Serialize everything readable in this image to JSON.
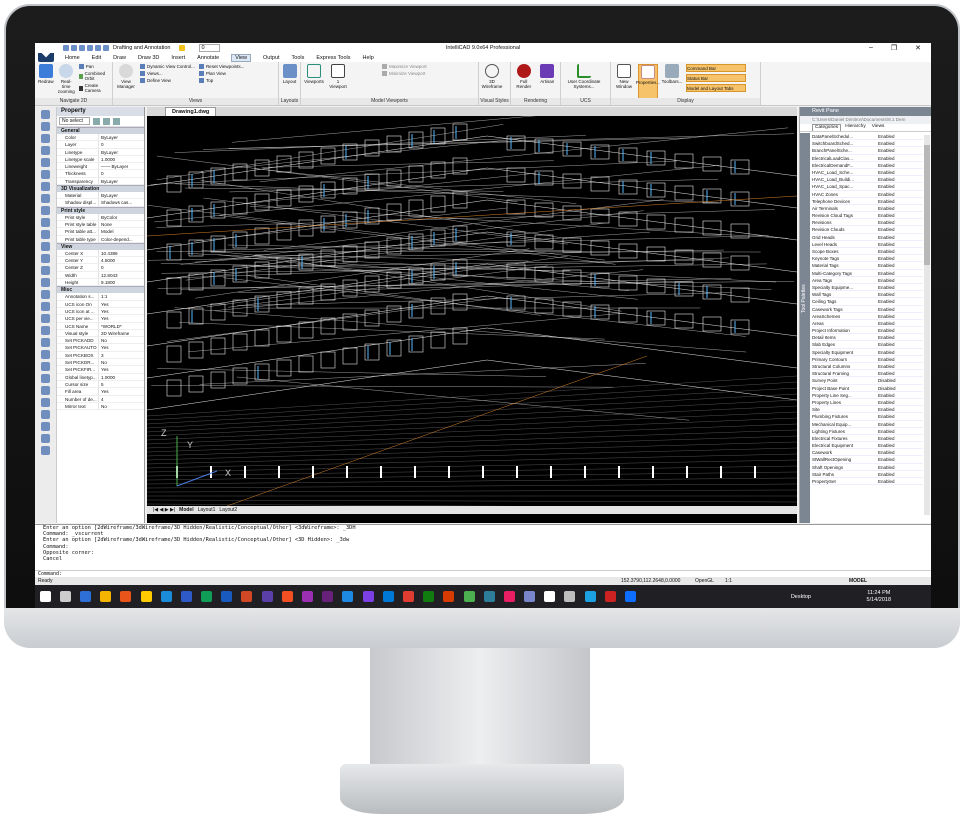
{
  "window": {
    "title": "IntelliCAD 9.0x64 Professional",
    "workspace": "Drafting and Annotation",
    "layer_value": "0",
    "controls": [
      "–",
      "❐",
      "✕"
    ]
  },
  "menu_tabs": [
    "Home",
    "Edit",
    "Draw",
    "Draw 3D",
    "Insert",
    "Annotate",
    "View",
    "Output",
    "Tools",
    "Express Tools",
    "Help"
  ],
  "active_tab": "View",
  "ribbon": {
    "navigate": {
      "label": "Navigate 2D",
      "buttons": [
        "Redraw",
        "Real-time zooming"
      ],
      "small": [
        "Pan",
        "Combined Orbit",
        "Create Camera"
      ]
    },
    "views": {
      "label": "Views",
      "buttons": [
        "View Manager"
      ],
      "small": [
        "Dynamic View Control...",
        "Views...",
        "Define View",
        "Reset Viewpoints...",
        "Plan View",
        "Top"
      ]
    },
    "layouts": {
      "label": "Layouts",
      "buttons": [
        "Layout"
      ]
    },
    "model_viewports": {
      "label": "Model Viewports",
      "buttons": [
        "Viewports",
        "1 Viewport"
      ],
      "small": [
        "Maximize Viewport",
        "Minimize Viewport"
      ]
    },
    "visual_styles": {
      "label": "Visual Styles",
      "buttons": [
        "3D Wireframe"
      ]
    },
    "rendering": {
      "label": "Rendering",
      "buttons": [
        "Full Render",
        "Artisan"
      ]
    },
    "ucs": {
      "label": "UCS",
      "buttons": [
        "User Coordinate Systems..."
      ]
    },
    "display": {
      "label": "Display",
      "buttons": [
        "New Window",
        "Properties...",
        "Toolbars..."
      ],
      "toggles": [
        "Command Bar",
        "Status Bar",
        "Model and Layout Tabs"
      ]
    }
  },
  "properties": {
    "title": "Property",
    "selection": "No select",
    "sections": [
      {
        "name": "General",
        "rows": [
          [
            "Color",
            "ByLayer"
          ],
          [
            "Layer",
            "0"
          ],
          [
            "Linetype",
            "ByLayer"
          ],
          [
            "Linetype scale",
            "1.0000"
          ],
          [
            "Lineweight",
            "—— ByLayer"
          ],
          [
            "Thickness",
            "0"
          ],
          [
            "Transparency",
            "ByLayer"
          ]
        ]
      },
      {
        "name": "3D Visualization",
        "rows": [
          [
            "Material",
            "ByLayer"
          ],
          [
            "Shadow displ...",
            "Shadows cas..."
          ]
        ]
      },
      {
        "name": "Print style",
        "rows": [
          [
            "Print style",
            "ByColor"
          ],
          [
            "Print style table",
            "None"
          ],
          [
            "Print table att...",
            "Model"
          ],
          [
            "Print table type",
            "Color-depend..."
          ]
        ]
      },
      {
        "name": "View",
        "rows": [
          [
            "Center X",
            "10.4386"
          ],
          [
            "Center Y",
            "4.5000"
          ],
          [
            "Center Z",
            "0"
          ],
          [
            "Width",
            "12.8043"
          ],
          [
            "Height",
            "9.1800"
          ]
        ]
      },
      {
        "name": "Misc",
        "rows": [
          [
            "Annotation s...",
            "1:1"
          ],
          [
            "UCS icon On",
            "Yes"
          ],
          [
            "UCS icon at ...",
            "Yes"
          ],
          [
            "UCS per vie...",
            "Yes"
          ],
          [
            "UCS Name",
            "*WORLD*"
          ],
          [
            "Visual style",
            "2D Wireframe"
          ],
          [
            "Set PICKADD",
            "No"
          ],
          [
            "Set PICKAUTO",
            "Yes"
          ],
          [
            "Set PICKBOX",
            "3"
          ],
          [
            "Set PICKDR...",
            "No"
          ],
          [
            "Set PICKFIR...",
            "Yes"
          ],
          [
            "Global linetyp...",
            "1.0000"
          ],
          [
            "Cursor size",
            "5"
          ],
          [
            "Fill area",
            "Yes"
          ],
          [
            "Number of de...",
            "4"
          ],
          [
            "Mirror text",
            "No"
          ]
        ]
      }
    ]
  },
  "document": {
    "tab": "Drawing1.dwg",
    "layout_tabs": [
      "Model",
      "Layout1",
      "Layout2"
    ],
    "active_layout": "Model",
    "axis_labels": {
      "z": "Z",
      "y": "Y",
      "x": "X"
    }
  },
  "revit_pane": {
    "title": "Revit Pane",
    "path": "C:\\Users\\Daniel Dimitrov\\Documents\\8.1 Dem",
    "tabs": [
      "Categories",
      "Hierarchy",
      "Views"
    ],
    "side_label": "Tool Palettes",
    "rows": [
      [
        "DataPanelSchedul...",
        "Enabled"
      ],
      [
        "SwitchboardSched...",
        "Enabled"
      ],
      [
        "BranchPanelSche...",
        "Enabled"
      ],
      [
        "ElectricalLoadClas...",
        "Enabled"
      ],
      [
        "ElectricalDemandF...",
        "Enabled"
      ],
      [
        "HVAC_Load_Sche...",
        "Enabled"
      ],
      [
        "HVAC_Load_Buildi...",
        "Enabled"
      ],
      [
        "HVAC_Load_Spac...",
        "Enabled"
      ],
      [
        "HVAC Zones",
        "Enabled"
      ],
      [
        "Telephone Devices",
        "Enabled"
      ],
      [
        "Air Terminals",
        "Enabled"
      ],
      [
        "Revision Cloud Tags",
        "Enabled"
      ],
      [
        "Revisions",
        "Enabled"
      ],
      [
        "Revision Clouds",
        "Enabled"
      ],
      [
        "Grid Heads",
        "Enabled"
      ],
      [
        "Level Heads",
        "Enabled"
      ],
      [
        "Scope Boxes",
        "Enabled"
      ],
      [
        "Keynote Tags",
        "Enabled"
      ],
      [
        "Material Tags",
        "Enabled"
      ],
      [
        "Multi-Category Tags",
        "Enabled"
      ],
      [
        "Area Tags",
        "Enabled"
      ],
      [
        "Specialty Equipme...",
        "Enabled"
      ],
      [
        "Wall Tags",
        "Enabled"
      ],
      [
        "Ceiling Tags",
        "Enabled"
      ],
      [
        "Casework Tags",
        "Enabled"
      ],
      [
        "AreaSchemes",
        "Enabled"
      ],
      [
        "Areas",
        "Enabled"
      ],
      [
        "Project Information",
        "Enabled"
      ],
      [
        "Detail Items",
        "Enabled"
      ],
      [
        "Slab Edges",
        "Enabled"
      ],
      [
        "Specialty Equipment",
        "Enabled"
      ],
      [
        "Primary Contours",
        "Enabled"
      ],
      [
        "Structural Columns",
        "Enabled"
      ],
      [
        "Structural Framing",
        "Enabled"
      ],
      [
        "Survey Point",
        "Disabled"
      ],
      [
        "Project Base Point",
        "Disabled"
      ],
      [
        "Property Line Seg...",
        "Enabled"
      ],
      [
        "Property Lines",
        "Enabled"
      ],
      [
        "Site",
        "Enabled"
      ],
      [
        "Plumbing Fixtures",
        "Enabled"
      ],
      [
        "Mechanical Equip...",
        "Enabled"
      ],
      [
        "Lighting Fixtures",
        "Enabled"
      ],
      [
        "Electrical Fixtures",
        "Enabled"
      ],
      [
        "Electrical Equipment",
        "Enabled"
      ],
      [
        "Casework",
        "Enabled"
      ],
      [
        "StWallRectOpening",
        "Enabled"
      ],
      [
        "Shaft Openings",
        "Enabled"
      ],
      [
        "Stair Paths",
        "Enabled"
      ],
      [
        "PropertySet",
        "Enabled"
      ]
    ]
  },
  "command_history": [
    "Enter an option [2dWireframe/3dWireframe/3D Hidden/Realistic/Conceptual/Other] <3dWireframe>: _3DH",
    "Command: _vscurrent",
    "Enter an option [2dWireframe/3dWireframe/3D Hidden/Realistic/Conceptual/Other] <3D Hidden>: _3dw",
    "Command:",
    "Opposite corner:",
    "Cancel"
  ],
  "command_prompt": "Command:",
  "status": {
    "ready": "Ready",
    "coords": "152.3790,112.2648,0.0000",
    "renderer": "OpenGL",
    "scale": "1:1",
    "mode": "MODEL"
  },
  "taskbar": {
    "desktop_label": "Desktop",
    "time": "11:24 PM",
    "date": "5/14/2018",
    "icon_colors": [
      "#ffffff",
      "#cccccc",
      "#2d6fd6",
      "#f4b400",
      "#e8541a",
      "#ffcc00",
      "#1b8cd9",
      "#2e5ac7",
      "#0f9d58",
      "#185abd",
      "#d24726",
      "#5b3fa8",
      "#f25022",
      "#9a2fb4",
      "#68217a",
      "#1e88e5",
      "#7b3fe4",
      "#0078d7",
      "#e03c31",
      "#107c10",
      "#d83b01",
      "#4caf50",
      "#2d7d9a",
      "#e91e63",
      "#7986cb",
      "#ffffff",
      "#bdbdbd",
      "#1ba1e2",
      "#cc2222",
      "#0d6efd"
    ]
  },
  "colors": {
    "accent_orange": "#f6c36a",
    "canvas": "#000000",
    "wire": "#e6e6e6",
    "wire_blue": "#57b7ff"
  }
}
